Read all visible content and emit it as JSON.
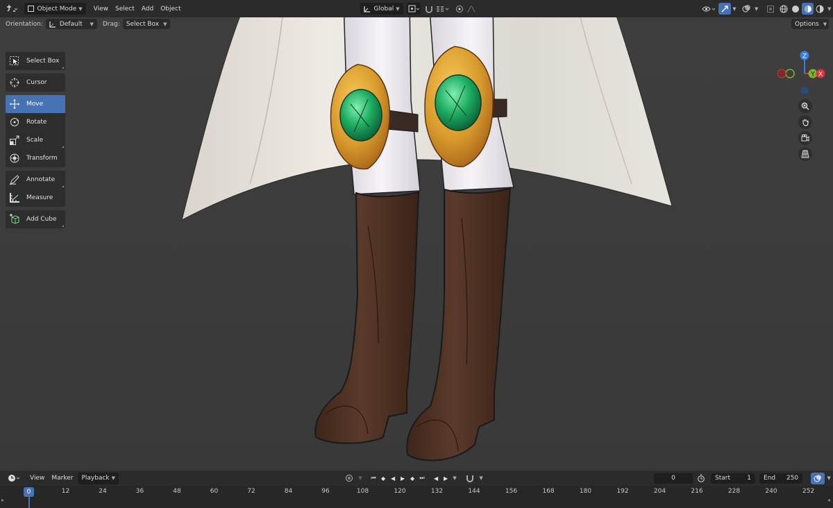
{
  "header": {
    "mode": "Object Mode",
    "menus": [
      "View",
      "Select",
      "Add",
      "Object"
    ],
    "transform_orientation": "Global"
  },
  "tool_settings": {
    "orientation_label": "Orientation:",
    "orientation_value": "Default",
    "drag_label": "Drag:",
    "drag_value": "Select Box",
    "options_label": "Options"
  },
  "toolbar": {
    "items": [
      "Select Box",
      "Cursor",
      "Move",
      "Rotate",
      "Scale",
      "Transform",
      "Annotate",
      "Measure",
      "Add Cube"
    ],
    "active": "Move"
  },
  "gizmo": {
    "z": "Z",
    "y": "Y",
    "x": "X",
    "colors": {
      "x": "#e0323f",
      "y": "#7fb12c",
      "z": "#3a7fdc"
    }
  },
  "timeline": {
    "menus": [
      "View",
      "Marker"
    ],
    "playback": "Playback",
    "current_frame": "0",
    "start_label": "Start",
    "start_value": "1",
    "end_label": "End",
    "end_value": "250",
    "ticks": [
      "12",
      "24",
      "36",
      "48",
      "60",
      "72",
      "84",
      "96",
      "108",
      "120",
      "132",
      "144",
      "156",
      "168",
      "180",
      "192",
      "204",
      "216",
      "228",
      "240",
      "252"
    ],
    "playhead_frame": "0"
  },
  "colors": {
    "accent": "#4772b3",
    "viewport_bg": "#3a3a3a",
    "header_bg": "#2b2b2b"
  }
}
